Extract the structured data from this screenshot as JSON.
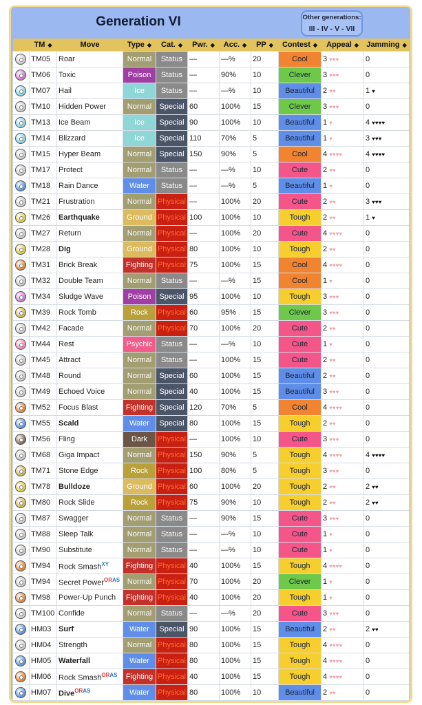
{
  "header": {
    "title": "Generation VI",
    "other_label": "Other generations:",
    "other_links": [
      "III",
      "IV",
      "V",
      "VII"
    ]
  },
  "columns": [
    "TM",
    "Move",
    "Type",
    "Cat.",
    "Pwr.",
    "Acc.",
    "PP",
    "Contest",
    "Appeal",
    "Jamming"
  ],
  "colors": {
    "type": {
      "Normal": "#a29e72",
      "Poison": "#a03ea6",
      "Ice": "#8fd6d6",
      "Water": "#5f8de8",
      "Ground": "#dcbb5e",
      "Fighting": "#c4302a",
      "Rock": "#b8a03a",
      "Psychic": "#f25b8a",
      "Dark": "#6b5646"
    },
    "cat": {
      "Status": "#8a8a8a",
      "Special": "#4b5568",
      "Physical": "#c92012"
    },
    "contest": {
      "Cool": "#f08431",
      "Clever": "#6ec84a",
      "Beautiful": "#5f8ee8",
      "Cute": "#f5568a",
      "Tough": "#f6cf2e"
    },
    "sup": {
      "XY": "#2a7fa8",
      "OR": "#d83030",
      "AS": "#2a6fc0"
    }
  },
  "rows": [
    {
      "tm": "TM05",
      "move": "Roar",
      "type": "Normal",
      "cat": "Status",
      "pwr": "—",
      "acc": "—%",
      "pp": "20",
      "contest": "Cool",
      "appeal": 3,
      "jam": 0
    },
    {
      "tm": "TM06",
      "move": "Toxic",
      "type": "Poison",
      "cat": "Status",
      "pwr": "—",
      "acc": "90%",
      "pp": "10",
      "contest": "Clever",
      "appeal": 3,
      "jam": 0
    },
    {
      "tm": "TM07",
      "move": "Hail",
      "type": "Ice",
      "cat": "Status",
      "pwr": "—",
      "acc": "—%",
      "pp": "10",
      "contest": "Beautiful",
      "appeal": 2,
      "jam": 1
    },
    {
      "tm": "TM10",
      "move": "Hidden Power",
      "type": "Normal",
      "cat": "Special",
      "pwr": "60",
      "acc": "100%",
      "pp": "15",
      "contest": "Clever",
      "appeal": 3,
      "jam": 0
    },
    {
      "tm": "TM13",
      "move": "Ice Beam",
      "type": "Ice",
      "cat": "Special",
      "pwr": "90",
      "acc": "100%",
      "pp": "10",
      "contest": "Beautiful",
      "appeal": 1,
      "jam": 4
    },
    {
      "tm": "TM14",
      "move": "Blizzard",
      "type": "Ice",
      "cat": "Special",
      "pwr": "110",
      "acc": "70%",
      "pp": "5",
      "contest": "Beautiful",
      "appeal": 1,
      "jam": 3
    },
    {
      "tm": "TM15",
      "move": "Hyper Beam",
      "type": "Normal",
      "cat": "Special",
      "pwr": "150",
      "acc": "90%",
      "pp": "5",
      "contest": "Cool",
      "appeal": 4,
      "jam": 4
    },
    {
      "tm": "TM17",
      "move": "Protect",
      "type": "Normal",
      "cat": "Status",
      "pwr": "—",
      "acc": "—%",
      "pp": "10",
      "contest": "Cute",
      "appeal": 2,
      "jam": 0
    },
    {
      "tm": "TM18",
      "move": "Rain Dance",
      "type": "Water",
      "cat": "Status",
      "pwr": "—",
      "acc": "—%",
      "pp": "5",
      "contest": "Beautiful",
      "appeal": 1,
      "jam": 0
    },
    {
      "tm": "TM21",
      "move": "Frustration",
      "type": "Normal",
      "cat": "Physical",
      "pwr": "—",
      "acc": "100%",
      "pp": "20",
      "contest": "Cute",
      "appeal": 2,
      "jam": 3
    },
    {
      "tm": "TM26",
      "move": "Earthquake",
      "bold": true,
      "type": "Ground",
      "cat": "Physical",
      "pwr": "100",
      "acc": "100%",
      "pp": "10",
      "contest": "Tough",
      "appeal": 2,
      "jam": 1
    },
    {
      "tm": "TM27",
      "move": "Return",
      "type": "Normal",
      "cat": "Physical",
      "pwr": "—",
      "acc": "100%",
      "pp": "20",
      "contest": "Cute",
      "appeal": 4,
      "jam": 0
    },
    {
      "tm": "TM28",
      "move": "Dig",
      "bold": true,
      "type": "Ground",
      "cat": "Physical",
      "pwr": "80",
      "acc": "100%",
      "pp": "10",
      "contest": "Tough",
      "appeal": 2,
      "jam": 0
    },
    {
      "tm": "TM31",
      "move": "Brick Break",
      "type": "Fighting",
      "cat": "Physical",
      "pwr": "75",
      "acc": "100%",
      "pp": "15",
      "contest": "Cool",
      "appeal": 4,
      "jam": 0
    },
    {
      "tm": "TM32",
      "move": "Double Team",
      "type": "Normal",
      "cat": "Status",
      "pwr": "—",
      "acc": "—%",
      "pp": "15",
      "contest": "Cool",
      "appeal": 1,
      "jam": 0
    },
    {
      "tm": "TM34",
      "move": "Sludge Wave",
      "type": "Poison",
      "cat": "Special",
      "pwr": "95",
      "acc": "100%",
      "pp": "10",
      "contest": "Tough",
      "appeal": 3,
      "jam": 0
    },
    {
      "tm": "TM39",
      "move": "Rock Tomb",
      "type": "Rock",
      "cat": "Physical",
      "pwr": "60",
      "acc": "95%",
      "pp": "15",
      "contest": "Clever",
      "appeal": 3,
      "jam": 0
    },
    {
      "tm": "TM42",
      "move": "Facade",
      "type": "Normal",
      "cat": "Physical",
      "pwr": "70",
      "acc": "100%",
      "pp": "20",
      "contest": "Cute",
      "appeal": 2,
      "jam": 0
    },
    {
      "tm": "TM44",
      "move": "Rest",
      "type": "Psychic",
      "cat": "Status",
      "pwr": "—",
      "acc": "—%",
      "pp": "10",
      "contest": "Cute",
      "appeal": 1,
      "jam": 0
    },
    {
      "tm": "TM45",
      "move": "Attract",
      "type": "Normal",
      "cat": "Status",
      "pwr": "—",
      "acc": "100%",
      "pp": "15",
      "contest": "Cute",
      "appeal": 2,
      "jam": 0
    },
    {
      "tm": "TM48",
      "move": "Round",
      "type": "Normal",
      "cat": "Special",
      "pwr": "60",
      "acc": "100%",
      "pp": "15",
      "contest": "Beautiful",
      "appeal": 2,
      "jam": 0
    },
    {
      "tm": "TM49",
      "move": "Echoed Voice",
      "type": "Normal",
      "cat": "Special",
      "pwr": "40",
      "acc": "100%",
      "pp": "15",
      "contest": "Beautiful",
      "appeal": 3,
      "jam": 0
    },
    {
      "tm": "TM52",
      "move": "Focus Blast",
      "type": "Fighting",
      "cat": "Special",
      "pwr": "120",
      "acc": "70%",
      "pp": "5",
      "contest": "Cool",
      "appeal": 4,
      "jam": 0
    },
    {
      "tm": "TM55",
      "move": "Scald",
      "bold": true,
      "type": "Water",
      "cat": "Special",
      "pwr": "80",
      "acc": "100%",
      "pp": "15",
      "contest": "Tough",
      "appeal": 2,
      "jam": 0
    },
    {
      "tm": "TM56",
      "move": "Fling",
      "type": "Dark",
      "cat": "Physical",
      "pwr": "—",
      "acc": "100%",
      "pp": "10",
      "contest": "Cute",
      "appeal": 3,
      "jam": 0
    },
    {
      "tm": "TM68",
      "move": "Giga Impact",
      "type": "Normal",
      "cat": "Physical",
      "pwr": "150",
      "acc": "90%",
      "pp": "5",
      "contest": "Tough",
      "appeal": 4,
      "jam": 4
    },
    {
      "tm": "TM71",
      "move": "Stone Edge",
      "type": "Rock",
      "cat": "Physical",
      "pwr": "100",
      "acc": "80%",
      "pp": "5",
      "contest": "Tough",
      "appeal": 3,
      "jam": 0
    },
    {
      "tm": "TM78",
      "move": "Bulldoze",
      "bold": true,
      "type": "Ground",
      "cat": "Physical",
      "pwr": "60",
      "acc": "100%",
      "pp": "20",
      "contest": "Tough",
      "appeal": 2,
      "jam": 2
    },
    {
      "tm": "TM80",
      "move": "Rock Slide",
      "type": "Rock",
      "cat": "Physical",
      "pwr": "75",
      "acc": "90%",
      "pp": "10",
      "contest": "Tough",
      "appeal": 2,
      "jam": 2
    },
    {
      "tm": "TM87",
      "move": "Swagger",
      "type": "Normal",
      "cat": "Status",
      "pwr": "—",
      "acc": "90%",
      "pp": "15",
      "contest": "Cute",
      "appeal": 3,
      "jam": 0
    },
    {
      "tm": "TM88",
      "move": "Sleep Talk",
      "type": "Normal",
      "cat": "Status",
      "pwr": "—",
      "acc": "—%",
      "pp": "10",
      "contest": "Cute",
      "appeal": 1,
      "jam": 0
    },
    {
      "tm": "TM90",
      "move": "Substitute",
      "type": "Normal",
      "cat": "Status",
      "pwr": "—",
      "acc": "—%",
      "pp": "10",
      "contest": "Cute",
      "appeal": 1,
      "jam": 0
    },
    {
      "tm": "TM94",
      "move": "Rock Smash",
      "sup": "XY",
      "type": "Fighting",
      "cat": "Physical",
      "pwr": "40",
      "acc": "100%",
      "pp": "15",
      "contest": "Tough",
      "appeal": 4,
      "jam": 0
    },
    {
      "tm": "TM94",
      "move": "Secret Power",
      "sup": "ORAS",
      "type": "Normal",
      "cat": "Physical",
      "pwr": "70",
      "acc": "100%",
      "pp": "20",
      "contest": "Clever",
      "appeal": 1,
      "jam": 0
    },
    {
      "tm": "TM98",
      "move": "Power-Up Punch",
      "type": "Fighting",
      "cat": "Physical",
      "pwr": "40",
      "acc": "100%",
      "pp": "20",
      "contest": "Tough",
      "appeal": 1,
      "jam": 0
    },
    {
      "tm": "TM100",
      "move": "Confide",
      "type": "Normal",
      "cat": "Status",
      "pwr": "—",
      "acc": "—%",
      "pp": "20",
      "contest": "Cute",
      "appeal": 3,
      "jam": 0
    },
    {
      "tm": "HM03",
      "move": "Surf",
      "bold": true,
      "type": "Water",
      "cat": "Special",
      "pwr": "90",
      "acc": "100%",
      "pp": "15",
      "contest": "Beautiful",
      "appeal": 2,
      "jam": 2
    },
    {
      "tm": "HM04",
      "move": "Strength",
      "type": "Normal",
      "cat": "Physical",
      "pwr": "80",
      "acc": "100%",
      "pp": "15",
      "contest": "Tough",
      "appeal": 4,
      "jam": 0
    },
    {
      "tm": "HM05",
      "move": "Waterfall",
      "bold": true,
      "type": "Water",
      "cat": "Physical",
      "pwr": "80",
      "acc": "100%",
      "pp": "15",
      "contest": "Tough",
      "appeal": 4,
      "jam": 0
    },
    {
      "tm": "HM06",
      "move": "Rock Smash",
      "sup": "ORAS",
      "type": "Fighting",
      "cat": "Physical",
      "pwr": "40",
      "acc": "100%",
      "pp": "15",
      "contest": "Tough",
      "appeal": 4,
      "jam": 0
    },
    {
      "tm": "HM07",
      "move": "Dive",
      "bold": true,
      "sup": "ORAS",
      "type": "Water",
      "cat": "Physical",
      "pwr": "80",
      "acc": "100%",
      "pp": "10",
      "contest": "Beautiful",
      "appeal": 2,
      "jam": 0
    }
  ]
}
